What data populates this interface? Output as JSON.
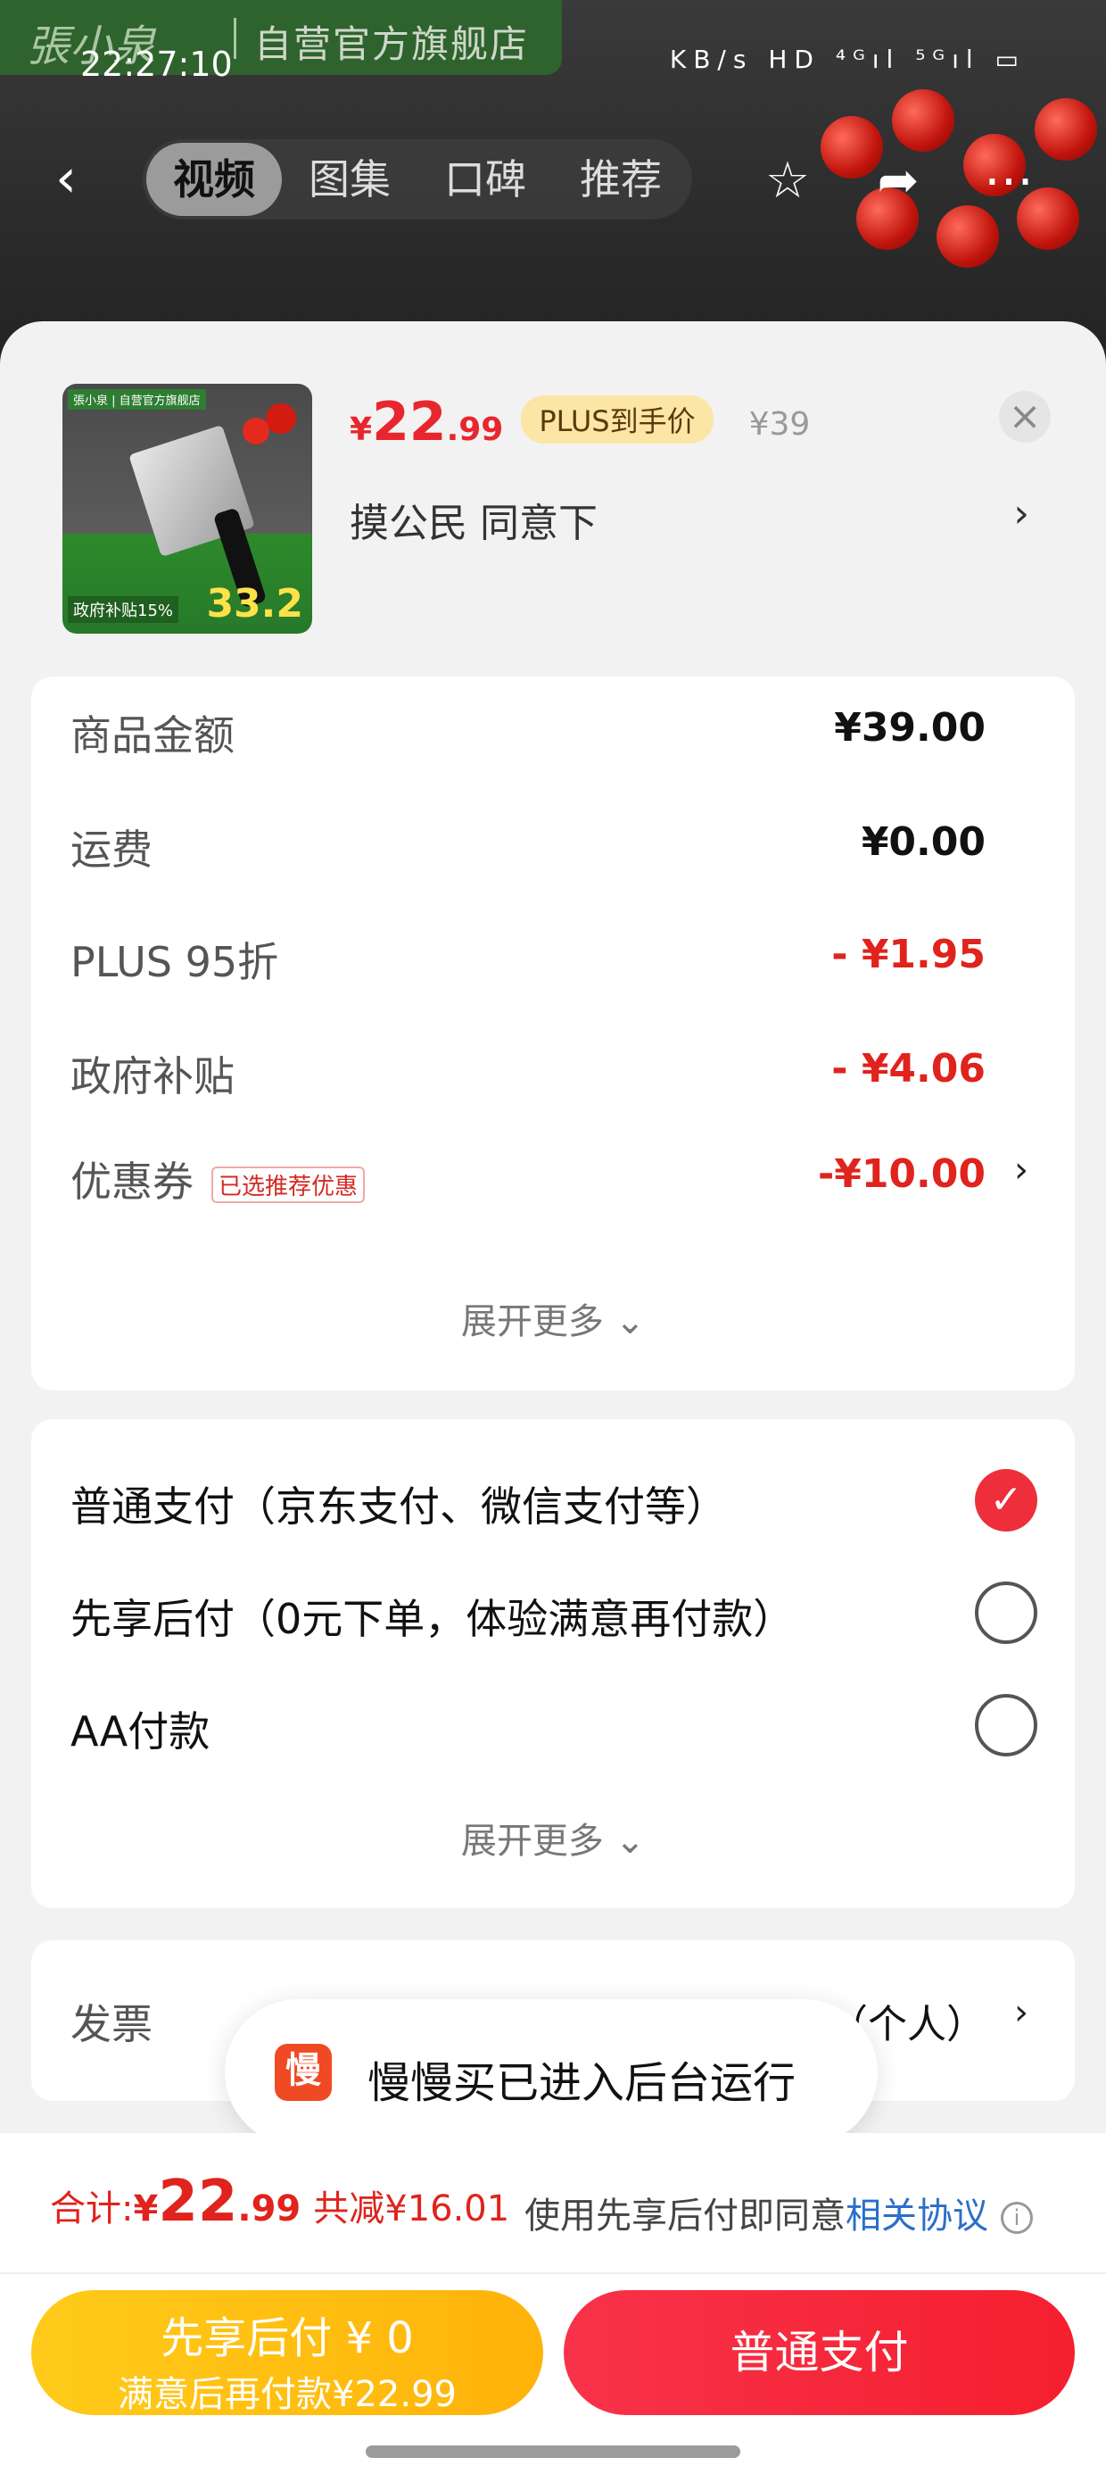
{
  "status": {
    "time": "22:27:10",
    "icons_text": "KB/s HD ⁴ᴳıl ⁵ᴳıl ▭"
  },
  "brand": {
    "logo": "張小泉",
    "store": "自营官方旗舰店"
  },
  "nav": {
    "tabs": [
      "视频",
      "图集",
      "口碑",
      "推荐"
    ],
    "active_tab": "视频"
  },
  "product": {
    "thumb": {
      "tag": "張小泉 | 自营官方旗舰店",
      "price": "33.2",
      "subsidy": "政府补贴15%"
    },
    "price_symbol": "¥",
    "price_int": "22",
    "price_dec": ".99",
    "plus_badge": "PLUS到手价",
    "original_price": "¥39",
    "spec": "摸公民  同意下",
    "spec_arrow": "›"
  },
  "summary": {
    "rows": [
      {
        "label": "商品金额",
        "value": "¥39.00"
      },
      {
        "label": "运费",
        "value": "¥0.00"
      },
      {
        "label": "PLUS 95折",
        "value": "- ¥1.95"
      },
      {
        "label": "政府补贴",
        "value": "- ¥4.06"
      },
      {
        "label": "优惠券",
        "value": "-¥10.00",
        "tag": "已选推荐优惠"
      }
    ],
    "expand": "展开更多 ⌄"
  },
  "payment": {
    "options": [
      {
        "label": "普通支付（京东支付、微信支付等）",
        "checked": true
      },
      {
        "label": "先享后付（0元下单，体验满意再付款）",
        "checked": false
      },
      {
        "label": "AA付款",
        "checked": false
      }
    ],
    "expand": "展开更多 ⌄"
  },
  "invoice": {
    "label": "发票",
    "value": "（个人）",
    "arrow": "›"
  },
  "toast": {
    "icon": "慢",
    "text": "慢慢买已进入后台运行"
  },
  "footer": {
    "total_label": "合计:",
    "total_sym": "¥",
    "total_int": "22",
    "total_dec": ".99",
    "total_save": "共减¥16.01",
    "agree_text": "使用先享后付即同意",
    "agree_link": "相关协议",
    "btn_later_l1": "先享后付 ¥ 0",
    "btn_later_l2": "满意后再付款¥22.99",
    "btn_pay": "普通支付"
  },
  "colors": {
    "accent_red": "#e0231c",
    "plus_gold": "#fbe6a6",
    "later_yellow": "#ffb30a"
  }
}
